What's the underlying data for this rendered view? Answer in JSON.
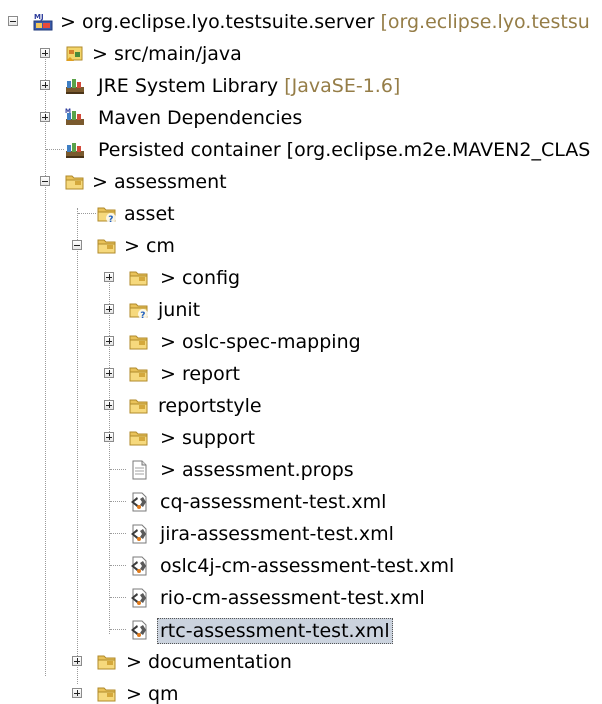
{
  "tree": {
    "root": {
      "label": "> org.eclipse.lyo.testsuite.server",
      "qualifier": "[org.eclipse.lyo.testsu"
    },
    "src": {
      "label": "> src/main/java"
    },
    "jre": {
      "label": "JRE System Library",
      "qualifier": "[JavaSE-1.6]"
    },
    "maven": {
      "label": "Maven Dependencies"
    },
    "persisted": {
      "label": "Persisted container [org.eclipse.m2e.MAVEN2_CLAS"
    },
    "assessment": {
      "label": "> assessment"
    },
    "asset": {
      "label": "asset"
    },
    "cm": {
      "label": "> cm"
    },
    "config": {
      "label": "> config"
    },
    "junit": {
      "label": "junit"
    },
    "oslc_spec_mapping": {
      "label": "> oslc-spec-mapping"
    },
    "report": {
      "label": "> report"
    },
    "reportstyle": {
      "label": "reportstyle"
    },
    "support": {
      "label": "> support"
    },
    "assessment_props": {
      "label": "> assessment.props"
    },
    "cq_xml": {
      "label": "cq-assessment-test.xml"
    },
    "jira_xml": {
      "label": "jira-assessment-test.xml"
    },
    "oslc4j_xml": {
      "label": "oslc4j-cm-assessment-test.xml"
    },
    "rio_xml": {
      "label": "rio-cm-assessment-test.xml"
    },
    "rtc_xml": {
      "label": "rtc-assessment-test.xml"
    },
    "documentation": {
      "label": "> documentation"
    },
    "qm": {
      "label": "> qm"
    }
  },
  "icons": {
    "project": "maven-java-project-icon",
    "package_root": "source-folder-icon",
    "library": "library-icon",
    "folder": "folder-icon",
    "file": "properties-file-icon",
    "xml": "xml-file-icon"
  }
}
